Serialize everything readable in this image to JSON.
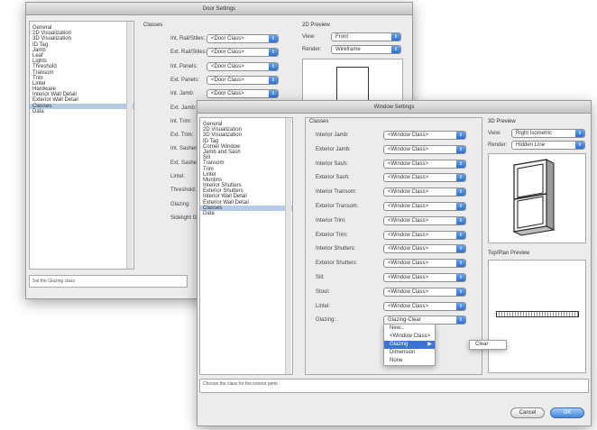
{
  "door_settings": {
    "title": "Door Settings",
    "categories": [
      "General",
      "2D Visualization",
      "3D Visualization",
      "ID Tag",
      "Jamb",
      "Leaf",
      "Lights",
      "Threshold",
      "Transom",
      "Trim",
      "Lintel",
      "Hardware",
      "Interior Wall Detail",
      "Exterior Wall Detail",
      "Classes",
      "Data"
    ],
    "selected_category": "Classes",
    "classes_heading": "Classes",
    "class_rows": [
      {
        "label": "Int. Rail/Stiles:",
        "value": "<Door Class>"
      },
      {
        "label": "Ext. Rail/Stiles:",
        "value": "<Door Class>"
      },
      {
        "label": "Int. Panels:",
        "value": "<Door Class>"
      },
      {
        "label": "Ext. Panels:",
        "value": "<Door Class>"
      },
      {
        "label": "Int. Jamb:",
        "value": "<Door Class>"
      },
      {
        "label": "Ext. Jamb:",
        "value": ""
      },
      {
        "label": "Int. Trim:",
        "value": ""
      },
      {
        "label": "Ext. Trim:",
        "value": ""
      },
      {
        "label": "Int. Sashes:",
        "value": ""
      },
      {
        "label": "Ext. Sashes:",
        "value": ""
      },
      {
        "label": "Lintel:",
        "value": ""
      },
      {
        "label": "Threshold:",
        "value": ""
      },
      {
        "label": "Glazing:",
        "value": ""
      },
      {
        "label": "Sidelight Glz:",
        "value": ""
      }
    ],
    "preview_heading": "2D Preview",
    "view_label": "View:",
    "view_value": "Front",
    "render_label": "Render:",
    "render_value": "Wireframe",
    "status": "Set the Glazing class"
  },
  "window_settings": {
    "title": "Window Settings",
    "categories": [
      "General",
      "2D Visualization",
      "3D Visualization",
      "ID Tag",
      "Corner Window",
      "Jamb and Sash",
      "Sill",
      "Transom",
      "Trim",
      "Lintel",
      "Muntins",
      "Interior Shutters",
      "Exterior Shutters",
      "Interior Wall Detail",
      "Exterior Wall Detail",
      "Classes",
      "Data"
    ],
    "selected_category": "Classes",
    "classes_heading": "Classes",
    "class_rows": [
      {
        "label": "Interior Jamb:",
        "value": "<Window Class>"
      },
      {
        "label": "Exterior Jamb:",
        "value": "<Window Class>"
      },
      {
        "label": "Interior Sash:",
        "value": "<Window Class>"
      },
      {
        "label": "Exterior Sash:",
        "value": "<Window Class>"
      },
      {
        "label": "Interior Transom:",
        "value": "<Window Class>"
      },
      {
        "label": "Exterior Transom:",
        "value": "<Window Class>"
      },
      {
        "label": "Interior Trim:",
        "value": "<Window Class>"
      },
      {
        "label": "Exterior Trim:",
        "value": "<Window Class>"
      },
      {
        "label": "Interior Shutters:",
        "value": "<Window Class>"
      },
      {
        "label": "Exterior Shutters:",
        "value": "<Window Class>"
      },
      {
        "label": "Sill:",
        "value": "<Window Class>"
      },
      {
        "label": "Stool:",
        "value": "<Window Class>"
      },
      {
        "label": "Lintel:",
        "value": "<Window Class>"
      },
      {
        "label": "Glazing:",
        "value": "Glazing-Clear"
      }
    ],
    "preview_heading": "3D Preview",
    "view_label": "View:",
    "view_value": "Right Isometric",
    "render_label": "Render:",
    "render_value": "Hidden Line",
    "top_plan_heading": "Top/Plan Preview",
    "status": "Choose the class for the interior jamb",
    "cancel_label": "Cancel",
    "ok_label": "OK",
    "glazing_menu": {
      "items": [
        "New...",
        "<Window Class>",
        "Glazing",
        "Dimension",
        "None"
      ],
      "highlighted": "Glazing",
      "submenu_items": [
        "Clear"
      ]
    }
  },
  "colors": {
    "selection": "#b7cbe6",
    "menu_highlight": "#3b72d6",
    "popup_arrow": "#2d6fd0"
  }
}
